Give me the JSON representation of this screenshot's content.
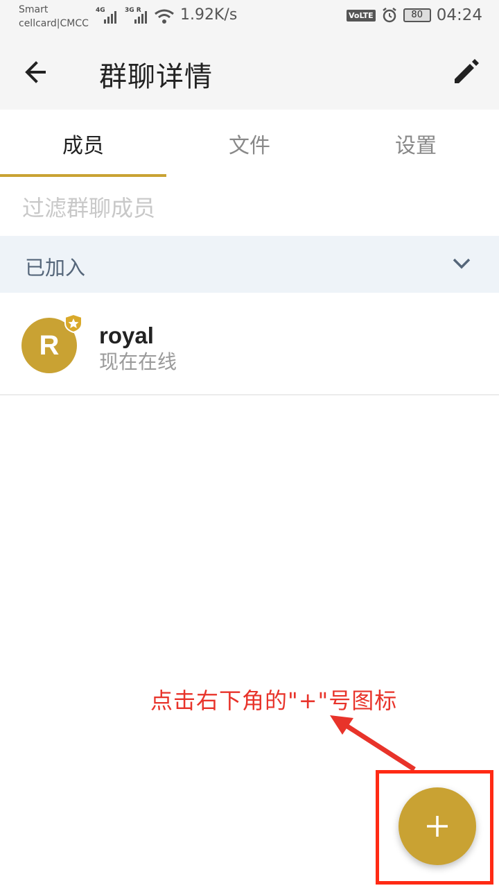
{
  "status_bar": {
    "carrier_line1": "Smart",
    "carrier_line2": "cellcard|CMCC",
    "signal1_label": "4G",
    "signal2_label": "3G R",
    "net_speed": "1.92K/s",
    "volte": "VoLTE",
    "battery": "80",
    "time": "04:24"
  },
  "header": {
    "title": "群聊详情",
    "back_icon": "arrow-left-icon",
    "edit_icon": "pencil-icon"
  },
  "tabs": [
    {
      "label": "成员",
      "active": true
    },
    {
      "label": "文件",
      "active": false
    },
    {
      "label": "设置",
      "active": false
    }
  ],
  "filter": {
    "placeholder": "过滤群聊成员",
    "value": ""
  },
  "section": {
    "title": "已加入",
    "icon": "chevron-down-icon"
  },
  "members": [
    {
      "initial": "R",
      "name": "royal",
      "status": "现在在线",
      "badge_icon": "crown-shield-icon"
    }
  ],
  "annotation": {
    "text": "点击右下角的\"+\"号图标"
  },
  "fab": {
    "icon": "plus-icon"
  },
  "colors": {
    "accent": "#c9a233",
    "annotation": "#e8332a",
    "section_bg": "#eef3f8"
  }
}
